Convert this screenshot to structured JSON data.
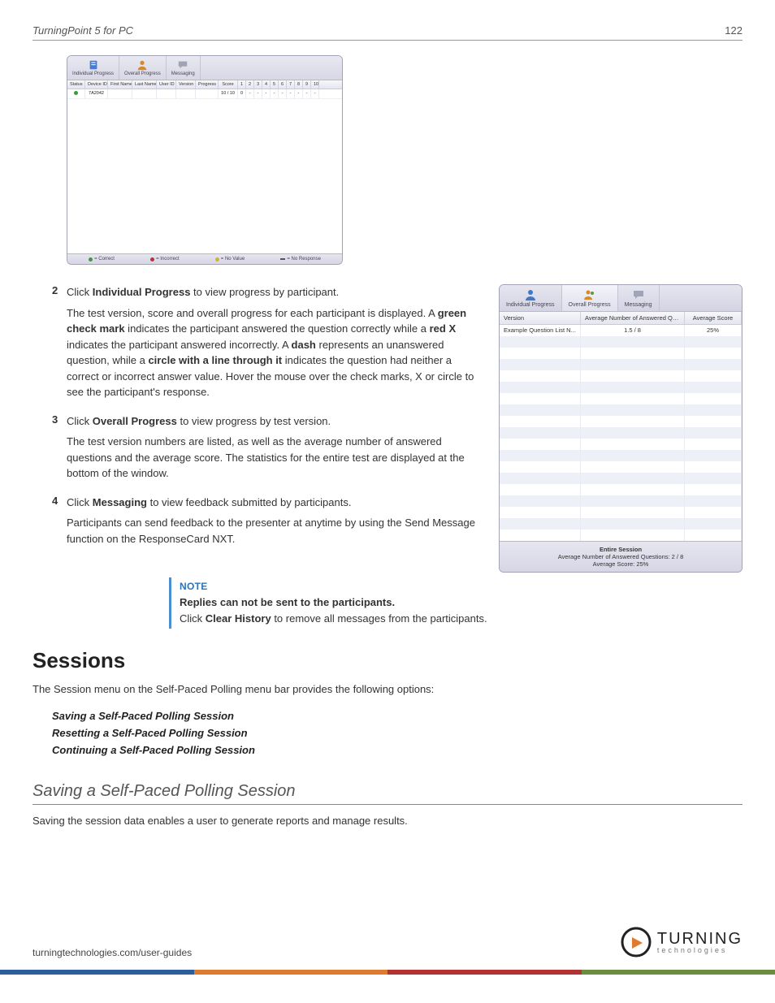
{
  "header": {
    "title": "TurningPoint 5 for PC",
    "page": "122"
  },
  "viewer1": {
    "tabs": {
      "individual": "Individual Progress",
      "overall": "Overall Progress",
      "messaging": "Messaging"
    },
    "cols": {
      "status": "Status",
      "device": "Device ID",
      "first": "First Name",
      "last": "Last Name",
      "user": "User ID",
      "version": "Version",
      "progress": "Progress",
      "score": "Score"
    },
    "qnums": [
      "1",
      "2",
      "3",
      "4",
      "5",
      "6",
      "7",
      "8",
      "9",
      "10"
    ],
    "row1": {
      "device": "7A2042",
      "progress": "",
      "score": "10 / 10",
      "q": [
        "0",
        "-",
        "-",
        "-",
        "-",
        "-",
        "-",
        "-",
        "-",
        "-"
      ]
    },
    "legend": {
      "correct": "= Correct",
      "incorrect": "= Incorrect",
      "novalue": "= No Value",
      "noresp": "= No Response"
    }
  },
  "steps": {
    "s2": {
      "line1a": "Click ",
      "bold1": "Individual Progress",
      "line1b": " to view progress by participant.",
      "para": "The test version, score and overall progress for each participant is displayed. A ",
      "bold2": "green check mark",
      "mid1": " indicates the participant answered the question correctly while a ",
      "bold3": "red X",
      "mid2": " indicates the participant answered incorrectly. A ",
      "bold4": "dash",
      "mid3": " represents an unanswered question, while a ",
      "bold5": "circle with a line through it",
      "mid4": " indicates the question had neither a correct or incorrect answer value. Hover the mouse over the check marks, X or circle to see the participant's response."
    },
    "s3": {
      "line1a": "Click ",
      "bold1": "Overall Progress",
      "line1b": " to view progress by test version.",
      "para": "The test version numbers are listed, as well as the average number of answered questions and the average score. The statistics for the entire test are displayed at the bottom of the window."
    },
    "s4": {
      "line1a": "Click ",
      "bold1": "Messaging",
      "line1b": " to view feedback submitted by participants.",
      "para": "Participants can send feedback to the presenter at anytime by using the Send Message function on the ResponseCard NXT."
    }
  },
  "viewer2": {
    "tabs": {
      "individual": "Individual Progress",
      "overall": "Overall Progress",
      "messaging": "Messaging"
    },
    "cols": {
      "version": "Version",
      "avgq": "Average Number of Answered Questions",
      "avgs": "Average Score"
    },
    "row": {
      "version": "Example Question List N...",
      "avgq": "1.5 / 8",
      "avgs": "25%"
    },
    "footer": {
      "title": "Entire Session",
      "line1": "Average Number of Answered Questions: 2 / 8",
      "line2": "Average Score: 25%"
    }
  },
  "note": {
    "title": "NOTE",
    "bold": "Replies can not be sent to the participants.",
    "pre": "Click ",
    "b2": "Clear History",
    "post": " to remove all messages from the participants."
  },
  "sessions": {
    "heading": "Sessions",
    "intro": "The Session menu on the Self-Paced Polling menu bar provides the following options:",
    "links": [
      "Saving a Self-Paced Polling Session",
      "Resetting a Self-Paced Polling Session",
      "Continuing a Self-Paced Polling Session"
    ],
    "subheading": "Saving a Self-Paced Polling Session",
    "subtext": "Saving the session data enables a user to generate reports and manage results."
  },
  "footer": {
    "link": "turningtechnologies.com/user-guides",
    "brand1": "TURNING",
    "brand2": "technologies"
  }
}
